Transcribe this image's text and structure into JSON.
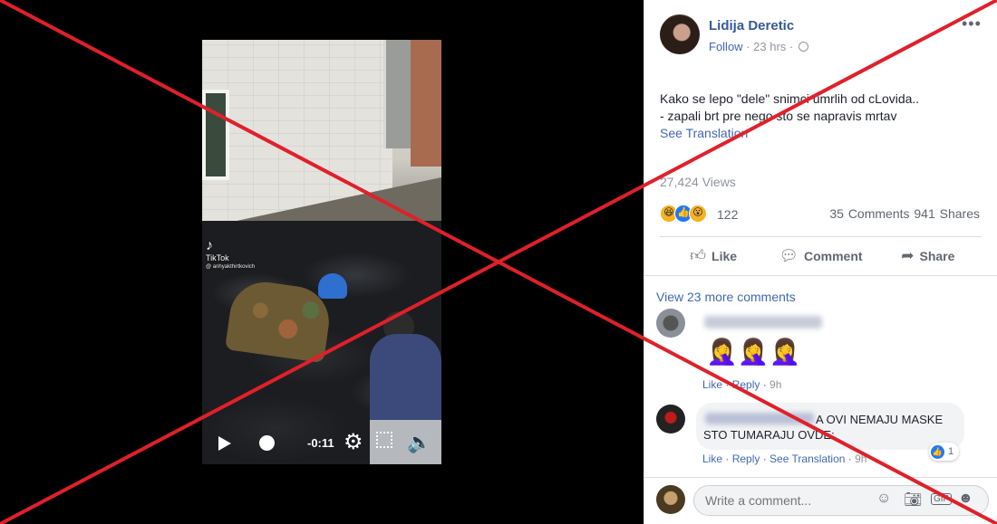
{
  "video": {
    "tiktok_logo": "TikTok",
    "tiktok_handle": "@ anhyakthirtkovich",
    "time_remaining": "-0:11"
  },
  "post": {
    "author": "Lidija Deretic",
    "follow_label": "Follow",
    "timestamp": "23 hrs",
    "more": "•••",
    "text_line1": "Kako se lepo \"dele\" snimci umrlih od cLovida..",
    "text_line2": "- zapali brt pre nego sto se napravis mrtav",
    "see_translation": "See Translation",
    "views": "27,424 Views",
    "reaction_count": "122",
    "comment_share_counts": "35 Comments  941 Shares",
    "actions": {
      "like": "Like",
      "comment": "Comment",
      "share": "Share"
    }
  },
  "comments": {
    "view_more": "View 23 more comments",
    "items": [
      {
        "emojis": "🤦‍♀️🤦‍♀️🤦‍♀️",
        "like": "Like",
        "reply": "Reply",
        "time": "9h"
      },
      {
        "text": "A OVI NEMAJU MASKE STO TUMARAJU OVDE:",
        "like": "Like",
        "reply": "Reply",
        "see_translation": "See Translation",
        "time": "9h",
        "like_count": "1"
      }
    ],
    "write_placeholder": "Write a comment..."
  },
  "colors": {
    "facebook_link": "#365899",
    "overlay_red": "#e0202a"
  },
  "icons": [
    "play-icon",
    "gear-icon",
    "fullscreen-icon",
    "volume-icon",
    "globe-icon",
    "like-icon",
    "comment-icon",
    "share-icon",
    "emoji-icon",
    "camera-icon",
    "gif-icon",
    "sticker-icon"
  ]
}
